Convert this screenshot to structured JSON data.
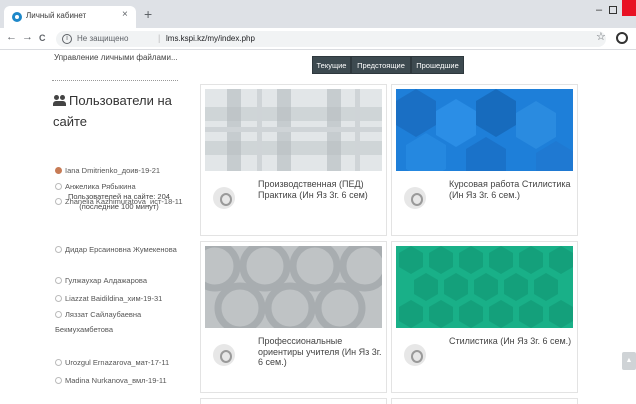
{
  "browser": {
    "tab_title": "Личный кабинет",
    "tab_close": "×",
    "new_tab": "+",
    "security_text": "Не защищено",
    "url": "lms.kspi.kz/my/index.php",
    "back": "←",
    "forward": "→",
    "reload": "C",
    "bookmark": "☆",
    "minimize": "–"
  },
  "sidebar": {
    "manage_files": "Управление личными файлами...",
    "users_heading": "Пользователи на сайте",
    "online_count": "Пользователей на сайте: 204 (последние 100 минут)",
    "users": [
      "Iana Dmitrienko_доив-19-21",
      "Анжелика Рябыкина",
      "Zhanelia Kazhimuratova_ист-18-11",
      "Дидар Ерсаиновна Жумекенова",
      "Гулжаухар Алдажарова",
      "Liazzat Baidildina_хим-19-31",
      "Ляззат Сайлаубаевна Бекмухамбетова",
      "Urozgul Ernazarova_мат-17-11",
      "Madina Nurkanova_вмл-19-11"
    ]
  },
  "filter": {
    "tabs": [
      "Текущие",
      "Предстоящие",
      "Прошедшие"
    ]
  },
  "courses": [
    {
      "title": "Производственная (ПЕД) Практика (Ин Яз 3г. 6 сем)",
      "pattern": "plaid",
      "color": "#d5dadd"
    },
    {
      "title": "Курсовая работа Стилистика (Ин Яз 3г. 6 сем.)",
      "pattern": "hex",
      "color": "#1e7fd9"
    },
    {
      "title": "Профессиональные ориентиры учителя (Ин Яз 3г. 6 сем.)",
      "pattern": "circles",
      "color": "#b7bcbe"
    },
    {
      "title": "Стилистика (Ин Яз 3г. 6 сем.)",
      "pattern": "hex",
      "color": "#19b088"
    }
  ],
  "colors": {
    "accent_dark": "#3d4a50",
    "browser_close": "#e81123"
  },
  "icons": {
    "scroll_top": "chevron-up-icon"
  }
}
